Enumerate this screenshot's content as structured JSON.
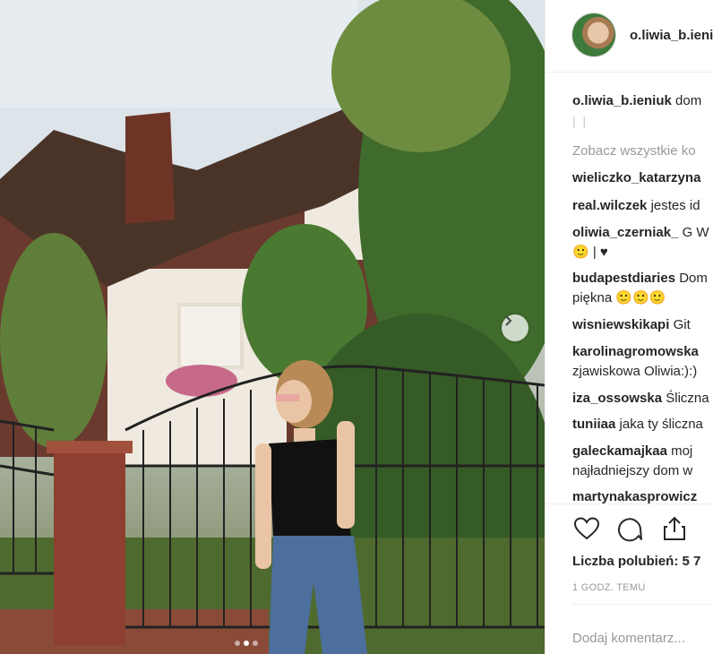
{
  "post": {
    "username": "o.liwia_b.ieniuk",
    "caption_user": "o.liwia_b.ieniuk",
    "caption_text": "dom",
    "caption_sub": "| |",
    "view_all": "Zobacz wszystkie ko",
    "likes_label": "Liczba polubień: 5 7",
    "time": "1 GODZ. TEMU",
    "add_comment_placeholder": "Dodaj komentarz..."
  },
  "comments": [
    {
      "user": "wieliczko_katarzyna",
      "text": ""
    },
    {
      "user": "real.wilczek",
      "text": "jestes id"
    },
    {
      "user": "oliwia_czerniak_",
      "text": "G W"
    },
    {
      "user": "",
      "text": "🙂 | ♥"
    },
    {
      "user": "budapestdiaries",
      "text": "Dom"
    },
    {
      "user": "",
      "text": "piękna 🙂🙂🙂"
    },
    {
      "user": "wisniewskikapi",
      "text": "Git"
    },
    {
      "user": "karolinagromowska",
      "text": ""
    },
    {
      "user": "",
      "text": "zjawiskowa Oliwia:):)"
    },
    {
      "user": "iza_ossowska",
      "text": "Śliczna"
    },
    {
      "user": "tuniiaa",
      "text": "jaka ty śliczna"
    },
    {
      "user": "galeckamajkaa",
      "text": "moj"
    },
    {
      "user": "",
      "text": "najładniejszy dom w"
    },
    {
      "user": "martynakasprowicz",
      "text": ""
    }
  ],
  "icons": {
    "like": "heart-icon",
    "comment": "comment-icon",
    "share": "share-icon",
    "next": "chevron-right-icon"
  },
  "carousel": {
    "slides": 3,
    "active_slide": 2
  },
  "colors": {
    "text": "#262626",
    "muted": "#999999",
    "border": "#efefef"
  }
}
